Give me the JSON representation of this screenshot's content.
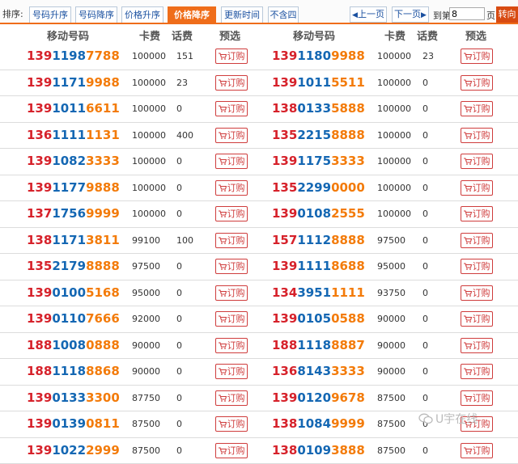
{
  "toolbar": {
    "sort_label": "排序:",
    "sort_buttons": [
      {
        "label": "号码升序",
        "active": false
      },
      {
        "label": "号码降序",
        "active": false
      },
      {
        "label": "价格升序",
        "active": false
      },
      {
        "label": "价格降序",
        "active": true
      },
      {
        "label": "更新时间",
        "active": false
      },
      {
        "label": "不含四",
        "active": false
      }
    ],
    "prev_label": "上一页",
    "next_label": "下一页",
    "goto_prefix": "到第",
    "page_value": "8",
    "goto_suffix": "页",
    "go_label": "转向"
  },
  "header": {
    "number": "移动号码",
    "card_fee": "卡费",
    "call_fee": "话费",
    "preselect": "预选"
  },
  "order_label": "订购",
  "rows": [
    {
      "left": {
        "a": "139",
        "b": "1198",
        "c": "7788",
        "fee": "100000",
        "credit": "151"
      },
      "right": {
        "a": "139",
        "b": "1180",
        "c": "9988",
        "fee": "100000",
        "credit": "23"
      }
    },
    {
      "left": {
        "a": "139",
        "b": "1171",
        "c": "9988",
        "fee": "100000",
        "credit": "23"
      },
      "right": {
        "a": "139",
        "b": "1011",
        "c": "5511",
        "fee": "100000",
        "credit": "0"
      }
    },
    {
      "left": {
        "a": "139",
        "b": "1011",
        "c": "6611",
        "fee": "100000",
        "credit": "0"
      },
      "right": {
        "a": "138",
        "b": "0133",
        "c": "5888",
        "fee": "100000",
        "credit": "0"
      }
    },
    {
      "left": {
        "a": "136",
        "b": "1111",
        "c": "1131",
        "fee": "100000",
        "credit": "400"
      },
      "right": {
        "a": "135",
        "b": "2215",
        "c": "8888",
        "fee": "100000",
        "credit": "0"
      }
    },
    {
      "left": {
        "a": "139",
        "b": "1082",
        "c": "3333",
        "fee": "100000",
        "credit": "0"
      },
      "right": {
        "a": "139",
        "b": "1175",
        "c": "3333",
        "fee": "100000",
        "credit": "0"
      }
    },
    {
      "left": {
        "a": "139",
        "b": "1177",
        "c": "9888",
        "fee": "100000",
        "credit": "0"
      },
      "right": {
        "a": "135",
        "b": "2299",
        "c": "0000",
        "fee": "100000",
        "credit": "0"
      }
    },
    {
      "left": {
        "a": "137",
        "b": "1756",
        "c": "9999",
        "fee": "100000",
        "credit": "0"
      },
      "right": {
        "a": "139",
        "b": "0108",
        "c": "2555",
        "fee": "100000",
        "credit": "0"
      }
    },
    {
      "left": {
        "a": "138",
        "b": "1171",
        "c": "3811",
        "fee": "99100",
        "credit": "100"
      },
      "right": {
        "a": "157",
        "b": "1112",
        "c": "8888",
        "fee": "97500",
        "credit": "0"
      }
    },
    {
      "left": {
        "a": "135",
        "b": "2179",
        "c": "8888",
        "fee": "97500",
        "credit": "0"
      },
      "right": {
        "a": "139",
        "b": "1111",
        "c": "8688",
        "fee": "95000",
        "credit": "0"
      }
    },
    {
      "left": {
        "a": "139",
        "b": "0100",
        "c": "5168",
        "fee": "95000",
        "credit": "0"
      },
      "right": {
        "a": "134",
        "b": "3951",
        "c": "1111",
        "fee": "93750",
        "credit": "0"
      }
    },
    {
      "left": {
        "a": "139",
        "b": "0110",
        "c": "7666",
        "fee": "92000",
        "credit": "0"
      },
      "right": {
        "a": "139",
        "b": "0105",
        "c": "0588",
        "fee": "90000",
        "credit": "0"
      }
    },
    {
      "left": {
        "a": "188",
        "b": "1008",
        "c": "0888",
        "fee": "90000",
        "credit": "0"
      },
      "right": {
        "a": "188",
        "b": "1118",
        "c": "8887",
        "fee": "90000",
        "credit": "0"
      }
    },
    {
      "left": {
        "a": "188",
        "b": "1118",
        "c": "8868",
        "fee": "90000",
        "credit": "0"
      },
      "right": {
        "a": "136",
        "b": "8143",
        "c": "3333",
        "fee": "90000",
        "credit": "0"
      }
    },
    {
      "left": {
        "a": "139",
        "b": "0133",
        "c": "3300",
        "fee": "87750",
        "credit": "0"
      },
      "right": {
        "a": "139",
        "b": "0120",
        "c": "9678",
        "fee": "87500",
        "credit": "0"
      }
    },
    {
      "left": {
        "a": "139",
        "b": "0139",
        "c": "0811",
        "fee": "87500",
        "credit": "0"
      },
      "right": {
        "a": "138",
        "b": "1084",
        "c": "9999",
        "fee": "87500",
        "credit": "0"
      }
    },
    {
      "left": {
        "a": "139",
        "b": "1022",
        "c": "2999",
        "fee": "87500",
        "credit": "0"
      },
      "right": {
        "a": "138",
        "b": "0109",
        "c": "3888",
        "fee": "87500",
        "credit": "0"
      }
    }
  ],
  "watermark": "U宇在线",
  "colors": {
    "accent": "#ef6d1a",
    "red": "#d6212a",
    "blue": "#1467b3",
    "orange": "#f37b0a"
  }
}
